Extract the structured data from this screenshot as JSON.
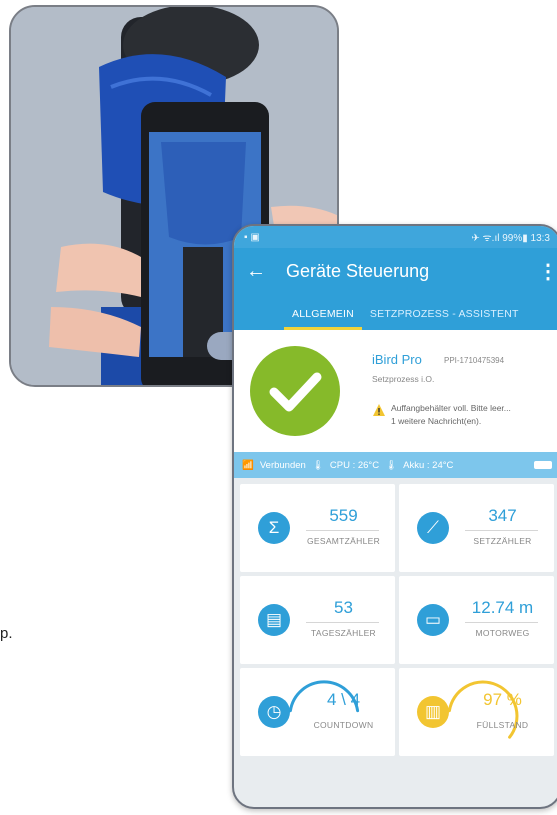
{
  "side_text": "p.",
  "status_bar": {
    "left": "▪ ▣",
    "right": "✈ ᯤ.ıl 99%▮ 13:3"
  },
  "app_bar": {
    "back": "←",
    "title": "Geräte Steuerung",
    "menu": "⋮"
  },
  "tabs": [
    {
      "label": "ALLGEMEIN",
      "active": true
    },
    {
      "label": "SETZPROZESS - ASSISTENT",
      "active": false
    }
  ],
  "device": {
    "name": "iBird Pro",
    "serial": "PPI-1710475394",
    "status": "Setzprozess i.O.",
    "warning_line1": "Auffangbehälter voll. Bitte leer...",
    "warning_line2": "1 weitere Nachricht(en).",
    "check_icon": "check-icon"
  },
  "info_bar": {
    "wifi": "Verbunden",
    "cpu": "CPU : 26°C",
    "akku": "Akku : 24°C"
  },
  "tiles": [
    {
      "icon": "sigma-icon",
      "glyph": "Σ",
      "value": "559",
      "label": "GESAMTZÄHLER"
    },
    {
      "icon": "rivet-tool-icon",
      "glyph": "⟋",
      "value": "347",
      "label": "SETZZÄHLER"
    },
    {
      "icon": "calendar-icon",
      "glyph": "▤",
      "value": "53",
      "label": "TAGESZÄHLER"
    },
    {
      "icon": "motor-icon",
      "glyph": "▭",
      "value": "12.74 m",
      "label": "MOTORWEG"
    },
    {
      "icon": "stopwatch-icon",
      "glyph": "◷",
      "value": "4 \\ 4",
      "label": "COUNTDOWN",
      "gauge_level": 0.75
    },
    {
      "icon": "bin-icon",
      "glyph": "▥",
      "value": "97 %",
      "label": "FÜLLSTAND",
      "gauge_level": 0.97
    }
  ],
  "colors": {
    "primary": "#2f9fd8",
    "success": "#86ba2a",
    "warning": "#f2c531",
    "accent": "#f2d33a"
  }
}
